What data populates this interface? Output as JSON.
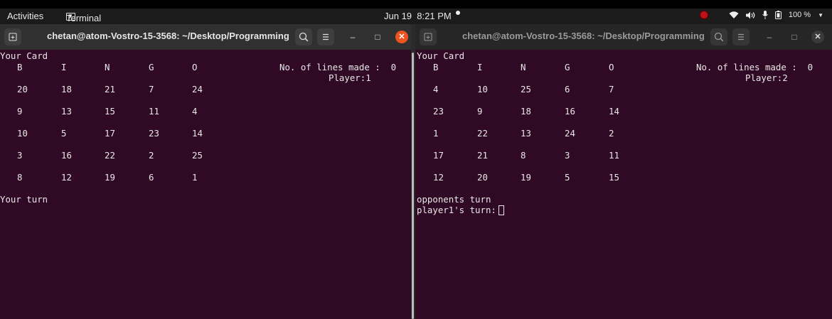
{
  "topbar": {
    "activities": "Activities",
    "app_name": "Terminal",
    "date": "Jun 19",
    "time": "8:21 PM",
    "battery": "100 %"
  },
  "windows": [
    {
      "title": "chetan@atom-Vostro-15-3568: ~/Desktop/Programming",
      "your_card": "Your Card",
      "headers": [
        "B",
        "I",
        "N",
        "G",
        "O"
      ],
      "rows": [
        [
          "20",
          "18",
          "21",
          "7",
          "24"
        ],
        [
          "9",
          "13",
          "15",
          "11",
          "4"
        ],
        [
          "10",
          "5",
          "17",
          "23",
          "14"
        ],
        [
          "3",
          "16",
          "22",
          "2",
          "25"
        ],
        [
          "8",
          "12",
          "19",
          "6",
          "1"
        ]
      ],
      "lines_made": "No. of lines made :  0",
      "player": "Player:1",
      "status_line1": "Your turn",
      "status_line2": ""
    },
    {
      "title": "chetan@atom-Vostro-15-3568: ~/Desktop/Programming",
      "your_card": "Your Card",
      "headers": [
        "B",
        "I",
        "N",
        "G",
        "O"
      ],
      "rows": [
        [
          "4",
          "10",
          "25",
          "6",
          "7"
        ],
        [
          "23",
          "9",
          "18",
          "16",
          "14"
        ],
        [
          "1",
          "22",
          "13",
          "24",
          "2"
        ],
        [
          "17",
          "21",
          "8",
          "3",
          "11"
        ],
        [
          "12",
          "20",
          "19",
          "5",
          "15"
        ]
      ],
      "lines_made": "No. of lines made :  0",
      "player": "Player:2",
      "status_line1": "opponents turn",
      "status_line2": "player1's turn:"
    }
  ]
}
